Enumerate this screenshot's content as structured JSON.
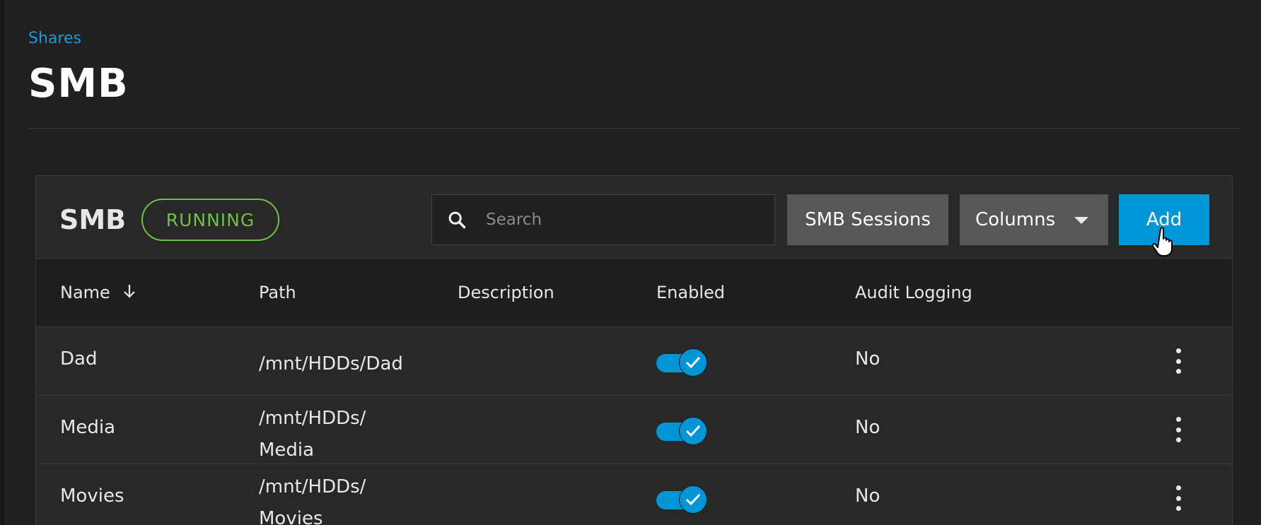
{
  "breadcrumb": {
    "label": "Shares"
  },
  "page": {
    "title": "SMB"
  },
  "card": {
    "title": "SMB",
    "status": "RUNNING",
    "status_color": "#71bf44",
    "search": {
      "placeholder": "Search",
      "value": "",
      "icon": "search-icon"
    },
    "buttons": {
      "sessions": "SMB Sessions",
      "columns": "Columns",
      "add": "Add"
    },
    "accent_color": "#0095d5"
  },
  "table": {
    "headers": {
      "name": "Name",
      "path": "Path",
      "description": "Description",
      "enabled": "Enabled",
      "audit": "Audit Logging"
    },
    "sort": {
      "column": "Name",
      "direction": "descending",
      "icon": "arrow-down-icon"
    },
    "rows": [
      {
        "name": "Dad",
        "path_line1": "/mnt/HDDs/Dad",
        "path_line2": "",
        "description": "",
        "enabled": true,
        "audit": "No"
      },
      {
        "name": "Media",
        "path_line1": "/mnt/HDDs/",
        "path_line2": "Media",
        "description": "",
        "enabled": true,
        "audit": "No"
      },
      {
        "name": "Movies",
        "path_line1": "/mnt/HDDs/",
        "path_line2": "Movies",
        "description": "",
        "enabled": true,
        "audit": "No"
      }
    ]
  }
}
